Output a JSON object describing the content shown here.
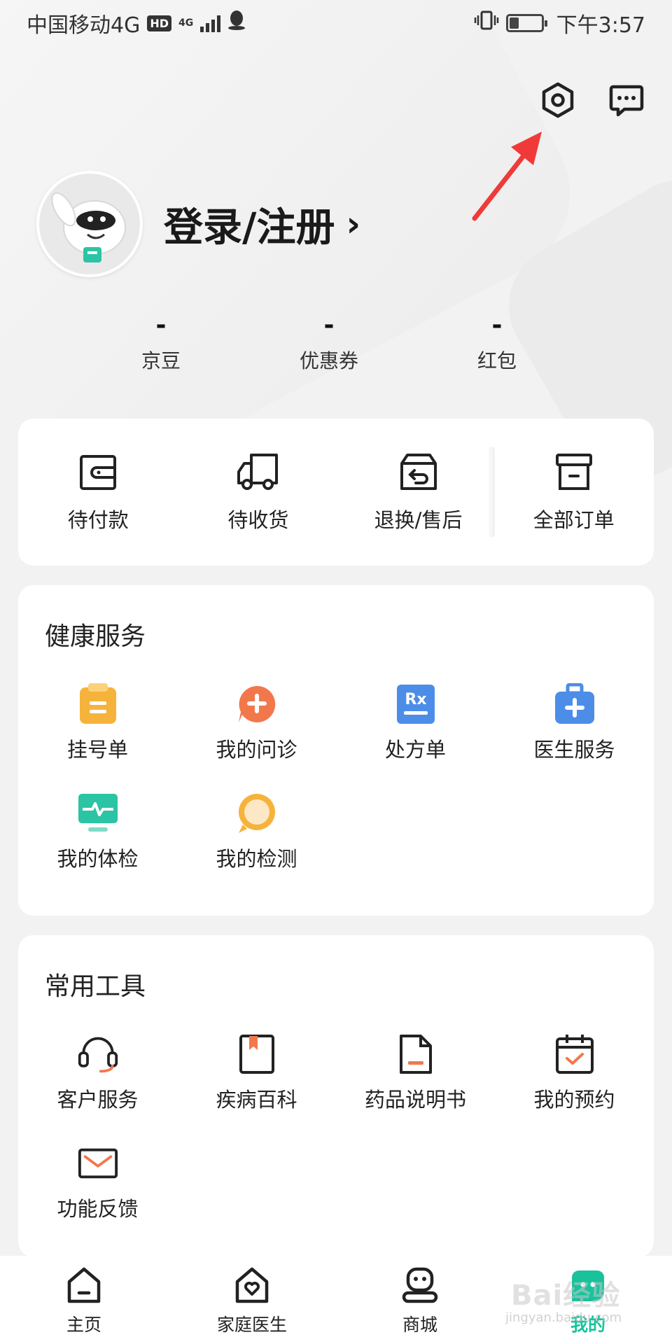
{
  "status_bar": {
    "carrier": "中国移动4G",
    "hd": "HD",
    "network": "4G",
    "time": "下午3:57",
    "battery_level": 0.3
  },
  "header_icons": {
    "settings": "settings-icon",
    "messages": "message-icon"
  },
  "profile": {
    "login_label": "登录/注册",
    "chevron": "›"
  },
  "stats": [
    {
      "value": "-",
      "label": "京豆"
    },
    {
      "value": "-",
      "label": "优惠券"
    },
    {
      "value": "-",
      "label": "红包"
    }
  ],
  "orders": [
    {
      "label": "待付款",
      "icon": "wallet-icon"
    },
    {
      "label": "待收货",
      "icon": "truck-icon"
    },
    {
      "label": "退换/售后",
      "icon": "return-box-icon"
    },
    {
      "label": "全部订单",
      "icon": "archive-box-icon"
    }
  ],
  "health": {
    "title": "健康服务",
    "items": [
      {
        "label": "挂号单",
        "icon": "clipboard-icon",
        "color": "#f6b33b"
      },
      {
        "label": "我的问诊",
        "icon": "consult-icon",
        "color": "#f2784b"
      },
      {
        "label": "处方单",
        "icon": "prescription-icon",
        "color": "#4c8de8",
        "glyph": "Rx"
      },
      {
        "label": "医生服务",
        "icon": "medical-bag-icon",
        "color": "#4c8de8"
      },
      {
        "label": "我的体检",
        "icon": "monitor-pulse-icon",
        "color": "#2bc4a4"
      },
      {
        "label": "我的检测",
        "icon": "test-circle-icon",
        "color": "#f6b33b"
      }
    ]
  },
  "tools": {
    "title": "常用工具",
    "items": [
      {
        "label": "客户服务",
        "icon": "headset-icon"
      },
      {
        "label": "疾病百科",
        "icon": "book-icon"
      },
      {
        "label": "药品说明书",
        "icon": "document-icon"
      },
      {
        "label": "我的预约",
        "icon": "calendar-check-icon"
      },
      {
        "label": "功能反馈",
        "icon": "mail-icon"
      }
    ]
  },
  "nav": [
    {
      "label": "主页",
      "icon": "home-icon"
    },
    {
      "label": "家庭医生",
      "icon": "family-doctor-icon"
    },
    {
      "label": "商城",
      "icon": "mall-icon"
    },
    {
      "label": "我的",
      "icon": "me-icon",
      "active": true
    }
  ],
  "accent_color": "#19c29c",
  "annotation_color": "#f03a3a",
  "watermark": {
    "text": "Bai经验",
    "sub": "jingyan.baidu.com"
  }
}
